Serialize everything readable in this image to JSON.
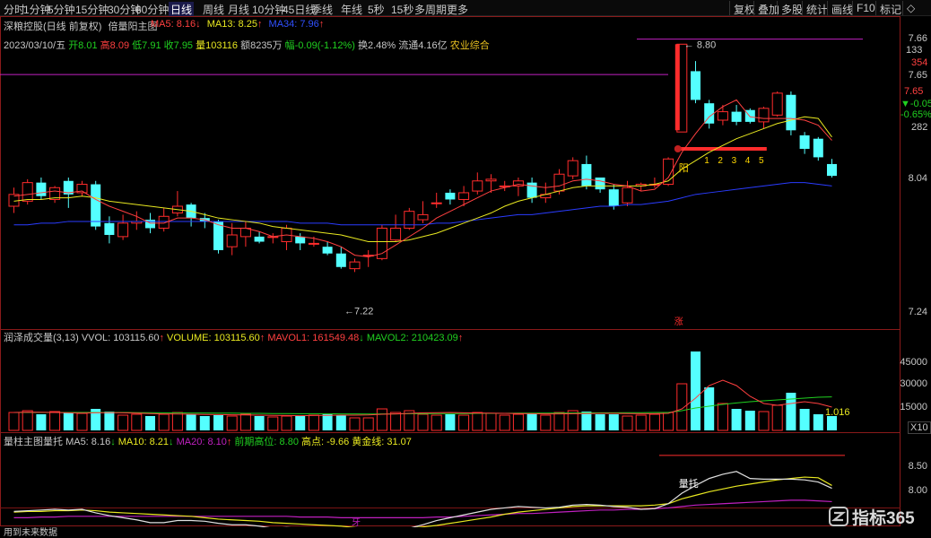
{
  "toolbar": {
    "periods": [
      "分时",
      "1分钟",
      "5分钟",
      "15分钟",
      "30分钟",
      "60分钟",
      "日线",
      "周线",
      "月线",
      "10分钟",
      "45日线",
      "季线",
      "年线",
      "5秒",
      "15秒",
      "多周期",
      "更多"
    ],
    "active_period": "日线",
    "right_buttons": [
      "复权",
      "叠加",
      "多股",
      "统计",
      "画线",
      "F10",
      "标记",
      "◇"
    ]
  },
  "main": {
    "title": "深粮控股(日线 前复权)",
    "indicator_name": "倍量阳主图",
    "ma5": "MA5: 8.16",
    "ma5_arrow": "↓",
    "ma13": "MA13: 8.25",
    "ma13_arrow": "↑",
    "ma34": "MA34: 7.96",
    "ma34_arrow": "↑",
    "date": "2023/03/10/五",
    "open": "开8.01",
    "high": "高8.09",
    "low": "低7.91",
    "close": "收7.95",
    "volume": "量103116",
    "amount": "额8235万",
    "change": "幅-0.09(-1.12%)",
    "turnover": "换2.48%",
    "float": "流通4.16亿",
    "sector": "农业综合",
    "high_mark": "8.80",
    "low_mark": "7.22",
    "yang_label": "阳",
    "zhang_label": "涨",
    "count_labels": [
      "1",
      "2",
      "3",
      "4",
      "5"
    ],
    "y_labels": [
      "7.66",
      "7.65",
      "7.24",
      "8.04"
    ],
    "info_box": [
      "7.66",
      "133",
      "354",
      "7.65",
      "▼-0.05",
      "-0.65%",
      "282"
    ]
  },
  "volume_panel": {
    "title": "润泽成交量(3,13)",
    "vvol": "VVOL: 103115.60",
    "vvol_arrow": "↑",
    "volume": "VOLUME: 103115.60",
    "volume_arrow": "↑",
    "mavol1": "MAVOL1: 161549.48",
    "mavol1_arrow": "↓",
    "mavol2": "MAVOL2: 210423.09",
    "mavol2_arrow": "↑",
    "y_labels": [
      "45000",
      "30000",
      "15000"
    ],
    "unit": "X10",
    "last_value": "1.016"
  },
  "bottom_panel": {
    "title": "量柱主图量托",
    "ma5": "MA5: 8.16",
    "ma5_arrow": "↓",
    "ma10": "MA10: 8.21",
    "ma10_arrow": "↓",
    "ma20": "MA20: 8.10",
    "ma20_arrow": "↑",
    "prev_high": "前期高位: 8.80",
    "high_point": "高点: -9.66",
    "golden": "黄金线: 31.07",
    "liangtuo": "量托",
    "ya": "牙",
    "y_labels": [
      "8.50",
      "8.00"
    ],
    "footer_note": "用到未来数据"
  },
  "watermark": {
    "text": "指标365"
  },
  "colors": {
    "up": "#ff2c2c",
    "down": "#54ffff",
    "ma5": "#ff4040",
    "ma13": "#e8e820",
    "ma34": "#2a3cff",
    "purple": "#c020c0",
    "green": "#20d020",
    "yellow": "#ffd700"
  },
  "chart_data": {
    "type": "candlestick",
    "candles": [
      {
        "o": 7.84,
        "c": 7.91,
        "h": 7.95,
        "l": 7.8
      },
      {
        "o": 7.87,
        "c": 7.98,
        "h": 8.0,
        "l": 7.85
      },
      {
        "o": 7.98,
        "c": 7.9,
        "h": 8.01,
        "l": 7.88
      },
      {
        "o": 7.88,
        "c": 7.95,
        "h": 7.96,
        "l": 7.86
      },
      {
        "o": 7.99,
        "c": 7.91,
        "h": 8.01,
        "l": 7.83
      },
      {
        "o": 7.92,
        "c": 7.97,
        "h": 7.99,
        "l": 7.9
      },
      {
        "o": 7.97,
        "c": 7.72,
        "h": 7.99,
        "l": 7.7
      },
      {
        "o": 7.74,
        "c": 7.67,
        "h": 7.78,
        "l": 7.62
      },
      {
        "o": 7.66,
        "c": 7.74,
        "h": 7.79,
        "l": 7.64
      },
      {
        "o": 7.74,
        "c": 7.75,
        "h": 7.81,
        "l": 7.7
      },
      {
        "o": 7.76,
        "c": 7.71,
        "h": 7.8,
        "l": 7.68
      },
      {
        "o": 7.71,
        "c": 7.78,
        "h": 7.83,
        "l": 7.69
      },
      {
        "o": 7.8,
        "c": 7.84,
        "h": 7.93,
        "l": 7.78
      },
      {
        "o": 7.85,
        "c": 7.77,
        "h": 7.86,
        "l": 7.72
      },
      {
        "o": 7.77,
        "c": 7.75,
        "h": 7.8,
        "l": 7.71
      },
      {
        "o": 7.75,
        "c": 7.58,
        "h": 7.76,
        "l": 7.56
      },
      {
        "o": 7.6,
        "c": 7.67,
        "h": 7.74,
        "l": 7.55
      },
      {
        "o": 7.66,
        "c": 7.71,
        "h": 7.75,
        "l": 7.6
      },
      {
        "o": 7.66,
        "c": 7.63,
        "h": 7.69,
        "l": 7.62
      },
      {
        "o": 7.66,
        "c": 7.66,
        "h": 7.68,
        "l": 7.62
      },
      {
        "o": 7.63,
        "c": 7.71,
        "h": 7.73,
        "l": 7.58
      },
      {
        "o": 7.66,
        "c": 7.62,
        "h": 7.68,
        "l": 7.58
      },
      {
        "o": 7.62,
        "c": 7.62,
        "h": 7.66,
        "l": 7.6
      },
      {
        "o": 7.6,
        "c": 7.56,
        "h": 7.63,
        "l": 7.55
      },
      {
        "o": 7.56,
        "c": 7.48,
        "h": 7.6,
        "l": 7.47
      },
      {
        "o": 7.47,
        "c": 7.51,
        "h": 7.53,
        "l": 7.45
      },
      {
        "o": 7.55,
        "c": 7.55,
        "h": 7.58,
        "l": 7.48
      },
      {
        "o": 7.53,
        "c": 7.71,
        "h": 7.73,
        "l": 7.52
      },
      {
        "o": 7.64,
        "c": 7.71,
        "h": 7.79,
        "l": 7.63
      },
      {
        "o": 7.71,
        "c": 7.81,
        "h": 7.83,
        "l": 7.7
      },
      {
        "o": 7.76,
        "c": 7.79,
        "h": 7.87,
        "l": 7.74
      },
      {
        "o": 7.86,
        "c": 7.86,
        "h": 7.92,
        "l": 7.83
      },
      {
        "o": 7.92,
        "c": 7.88,
        "h": 7.94,
        "l": 7.85
      },
      {
        "o": 7.88,
        "c": 7.92,
        "h": 7.96,
        "l": 7.84
      },
      {
        "o": 7.93,
        "c": 7.99,
        "h": 8.04,
        "l": 7.91
      },
      {
        "o": 7.99,
        "c": 8.0,
        "h": 8.03,
        "l": 7.92
      },
      {
        "o": 7.96,
        "c": 7.96,
        "h": 7.99,
        "l": 7.93
      },
      {
        "o": 7.96,
        "c": 7.99,
        "h": 8.01,
        "l": 7.9
      },
      {
        "o": 7.98,
        "c": 7.89,
        "h": 8.01,
        "l": 7.86
      },
      {
        "o": 7.89,
        "c": 7.91,
        "h": 7.98,
        "l": 7.86
      },
      {
        "o": 7.93,
        "c": 8.03,
        "h": 8.06,
        "l": 7.91
      },
      {
        "o": 8.02,
        "c": 8.11,
        "h": 8.13,
        "l": 8.0
      },
      {
        "o": 8.09,
        "c": 7.96,
        "h": 8.14,
        "l": 7.94
      },
      {
        "o": 8.01,
        "c": 7.94,
        "h": 8.01,
        "l": 7.92
      },
      {
        "o": 7.94,
        "c": 7.84,
        "h": 7.97,
        "l": 7.82
      },
      {
        "o": 7.86,
        "c": 7.95,
        "h": 7.99,
        "l": 7.84
      },
      {
        "o": 7.96,
        "c": 7.97,
        "h": 7.98,
        "l": 7.93
      },
      {
        "o": 7.97,
        "c": 7.97,
        "h": 8.01,
        "l": 7.95
      },
      {
        "o": 7.97,
        "c": 8.12,
        "h": 8.13,
        "l": 7.96
      },
      {
        "o": 8.28,
        "c": 8.8,
        "h": 8.8,
        "l": 8.29
      },
      {
        "o": 8.64,
        "c": 8.47,
        "h": 8.7,
        "l": 8.45
      },
      {
        "o": 8.45,
        "c": 8.33,
        "h": 8.47,
        "l": 8.3
      },
      {
        "o": 8.35,
        "c": 8.4,
        "h": 8.44,
        "l": 8.32
      },
      {
        "o": 8.4,
        "c": 8.34,
        "h": 8.44,
        "l": 8.32
      },
      {
        "o": 8.41,
        "c": 8.34,
        "h": 8.42,
        "l": 8.33
      },
      {
        "o": 8.34,
        "c": 8.42,
        "h": 8.43,
        "l": 8.3
      },
      {
        "o": 8.38,
        "c": 8.51,
        "h": 8.52,
        "l": 8.37
      },
      {
        "o": 8.5,
        "c": 8.29,
        "h": 8.52,
        "l": 8.26
      },
      {
        "o": 8.26,
        "c": 8.18,
        "h": 8.28,
        "l": 8.15
      },
      {
        "o": 8.24,
        "c": 8.13,
        "h": 8.25,
        "l": 8.11
      },
      {
        "o": 8.09,
        "c": 8.02,
        "h": 8.12,
        "l": 8.01
      }
    ],
    "ma5": [
      7.9,
      7.91,
      7.92,
      7.93,
      7.92,
      7.93,
      7.88,
      7.84,
      7.81,
      7.78,
      7.74,
      7.74,
      7.77,
      7.77,
      7.76,
      7.73,
      7.71,
      7.71,
      7.69,
      7.66,
      7.67,
      7.66,
      7.65,
      7.63,
      7.6,
      7.55,
      7.54,
      7.56,
      7.61,
      7.66,
      7.71,
      7.77,
      7.81,
      7.85,
      7.89,
      7.93,
      7.95,
      7.97,
      7.96,
      7.95,
      7.96,
      7.99,
      8.0,
      7.99,
      7.97,
      7.96,
      7.93,
      7.94,
      8.01,
      8.16,
      8.27,
      8.37,
      8.43,
      8.47,
      8.37,
      8.36,
      8.36,
      8.36,
      8.35,
      8.32,
      8.23
    ],
    "ma13": [
      7.87,
      7.88,
      7.88,
      7.89,
      7.89,
      7.9,
      7.89,
      7.87,
      7.86,
      7.85,
      7.84,
      7.83,
      7.82,
      7.81,
      7.79,
      7.77,
      7.76,
      7.75,
      7.74,
      7.72,
      7.71,
      7.7,
      7.69,
      7.68,
      7.67,
      7.65,
      7.63,
      7.63,
      7.63,
      7.64,
      7.66,
      7.68,
      7.71,
      7.74,
      7.77,
      7.8,
      7.84,
      7.87,
      7.89,
      7.91,
      7.93,
      7.95,
      7.96,
      7.96,
      7.96,
      7.96,
      7.96,
      7.97,
      7.99,
      8.06,
      8.11,
      8.16,
      8.2,
      8.24,
      8.27,
      8.3,
      8.33,
      8.35,
      8.37,
      8.36,
      8.25
    ],
    "ma34": [
      7.73,
      7.73,
      7.74,
      7.74,
      7.75,
      7.75,
      7.75,
      7.75,
      7.75,
      7.75,
      7.75,
      7.75,
      7.75,
      7.75,
      7.75,
      7.75,
      7.75,
      7.75,
      7.75,
      7.75,
      7.75,
      7.74,
      7.74,
      7.74,
      7.73,
      7.73,
      7.73,
      7.73,
      7.73,
      7.73,
      7.73,
      7.74,
      7.74,
      7.75,
      7.76,
      7.77,
      7.78,
      7.79,
      7.79,
      7.8,
      7.81,
      7.82,
      7.83,
      7.84,
      7.84,
      7.85,
      7.85,
      7.86,
      7.87,
      7.89,
      7.91,
      7.92,
      7.93,
      7.94,
      7.95,
      7.96,
      7.97,
      7.98,
      7.98,
      7.97,
      7.96
    ],
    "volume": [
      10000,
      11000,
      9000,
      10500,
      10000,
      9500,
      12000,
      10500,
      8500,
      9000,
      8000,
      9000,
      10000,
      9000,
      8000,
      8500,
      8000,
      9000,
      8000,
      7500,
      8000,
      8000,
      8500,
      9000,
      8500,
      7000,
      7000,
      12000,
      10000,
      11000,
      9000,
      8500,
      9000,
      8500,
      10000,
      9500,
      8500,
      9000,
      9500,
      8500,
      10000,
      11000,
      10500,
      9000,
      9000,
      8000,
      8500,
      9000,
      10000,
      26000,
      44000,
      24000,
      15000,
      12000,
      11000,
      10500,
      14000,
      21000,
      12000,
      9000,
      8000
    ],
    "mavol1": [
      10000,
      10200,
      10100,
      10000,
      9800,
      9600,
      9800,
      9900,
      9800,
      9600,
      9400,
      9200,
      9100,
      9000,
      8900,
      8800,
      8700,
      8600,
      8500,
      8400,
      8300,
      8200,
      8300,
      8400,
      8500,
      8500,
      8600,
      9000,
      9200,
      9500,
      9800,
      9900,
      10000,
      9800,
      9700,
      9600,
      9500,
      9400,
      9300,
      9200,
      9200,
      9300,
      9400,
      9500,
      9500,
      9400,
      9300,
      9300,
      9500,
      12000,
      18000,
      25000,
      28000,
      25000,
      19000,
      15000,
      14000,
      15000,
      16000,
      15000,
      13000
    ],
    "mavol2": [
      10000,
      10000,
      10000,
      10000,
      10000,
      10000,
      10000,
      10000,
      10000,
      9900,
      9900,
      9800,
      9800,
      9700,
      9700,
      9600,
      9600,
      9500,
      9500,
      9400,
      9400,
      9300,
      9300,
      9300,
      9200,
      9200,
      9100,
      9200,
      9200,
      9300,
      9300,
      9400,
      9400,
      9400,
      9500,
      9500,
      9500,
      9600,
      9600,
      9600,
      9700,
      9700,
      9800,
      9800,
      9800,
      9900,
      9900,
      10000,
      10000,
      11000,
      12500,
      13500,
      14500,
      15300,
      16000,
      16500,
      17000,
      17500,
      18000,
      18500,
      18700
    ]
  }
}
